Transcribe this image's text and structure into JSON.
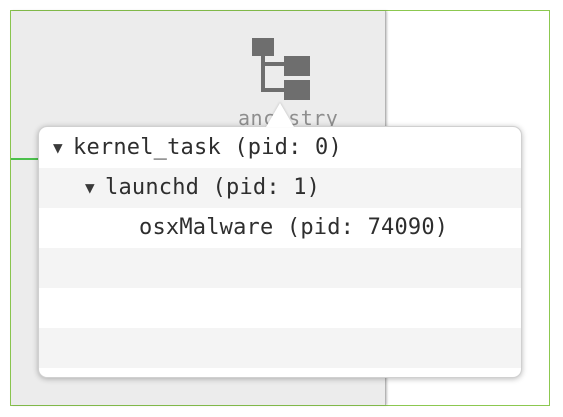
{
  "toolbar": {
    "ancestry_label": "ancestry",
    "ancestry_icon": "hierarchy-icon"
  },
  "process_tree": {
    "rows": [
      {
        "label": "kernel_task (pid: 0)",
        "expanded": true,
        "disclosure": "▼"
      },
      {
        "label": "launchd (pid: 1)",
        "expanded": true,
        "disclosure": "▼"
      },
      {
        "label": "osxMalware (pid: 74090)",
        "expanded": false,
        "disclosure": ""
      },
      {
        "label": ""
      },
      {
        "label": ""
      },
      {
        "label": ""
      }
    ]
  },
  "colors": {
    "frame_border": "#8cc850",
    "indicator_green": "#4cc04c",
    "panel_bg": "#ececec",
    "row_alt": "#f4f4f4",
    "text": "#2e2e2e",
    "icon_gray": "#6e6e6e"
  }
}
